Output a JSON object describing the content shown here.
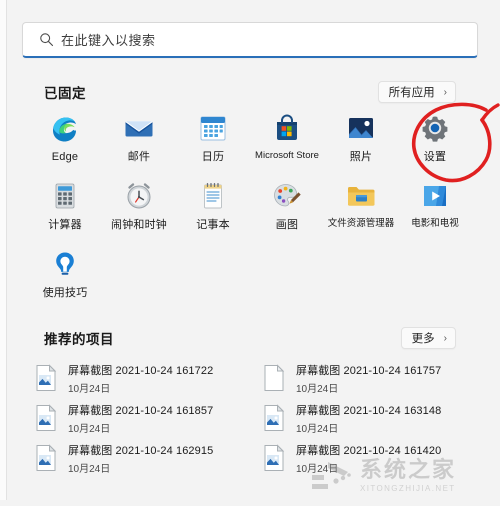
{
  "window": {
    "title": "Windows 11 Start Menu",
    "background": "#f3f3f3"
  },
  "search": {
    "placeholder": "在此键入以搜索",
    "value": "",
    "icon": "search-icon",
    "accent": "#2a6fb8"
  },
  "pinned": {
    "title": "已固定",
    "all_apps_label": "所有应用",
    "all_apps_chevron": "›",
    "apps": [
      {
        "label": "Edge",
        "icon": "edge-icon"
      },
      {
        "label": "邮件",
        "icon": "mail-icon"
      },
      {
        "label": "日历",
        "icon": "calendar-icon"
      },
      {
        "label": "Microsoft Store",
        "icon": "microsoft-store-icon"
      },
      {
        "label": "照片",
        "icon": "photos-icon"
      },
      {
        "label": "设置",
        "icon": "settings-gear-icon"
      },
      {
        "label": "计算器",
        "icon": "calculator-icon"
      },
      {
        "label": "闹钟和时钟",
        "icon": "alarms-clock-icon"
      },
      {
        "label": "记事本",
        "icon": "notepad-icon"
      },
      {
        "label": "画图",
        "icon": "paint-icon"
      },
      {
        "label": "文件资源管理器",
        "icon": "file-explorer-icon"
      },
      {
        "label": "电影和电视",
        "icon": "movies-tv-icon"
      },
      {
        "label": "使用技巧",
        "icon": "tips-lightbulb-icon"
      }
    ]
  },
  "recommended": {
    "title": "推荐的项目",
    "more_label": "更多",
    "more_chevron": "›",
    "items": [
      {
        "name": "屏幕截图 2021-10-24 161722",
        "date": "10月24日",
        "icon": "image-file-icon"
      },
      {
        "name": "屏幕截图 2021-10-24 161757",
        "date": "10月24日",
        "icon": "blank-document-icon"
      },
      {
        "name": "屏幕截图 2021-10-24 161857",
        "date": "10月24日",
        "icon": "image-file-icon"
      },
      {
        "name": "屏幕截图 2021-10-24 163148",
        "date": "10月24日",
        "icon": "image-file-icon"
      },
      {
        "name": "屏幕截图 2021-10-24 162915",
        "date": "10月24日",
        "icon": "image-file-icon"
      },
      {
        "name": "屏幕截图 2021-10-24 161420",
        "date": "10月24日",
        "icon": "image-file-icon"
      }
    ]
  },
  "annotation": {
    "type": "hand-drawn-circle",
    "color": "#e02020",
    "target": "设置"
  },
  "watermark": {
    "cn": "系统之家",
    "en": "XITONGZHIJIA.NET"
  }
}
